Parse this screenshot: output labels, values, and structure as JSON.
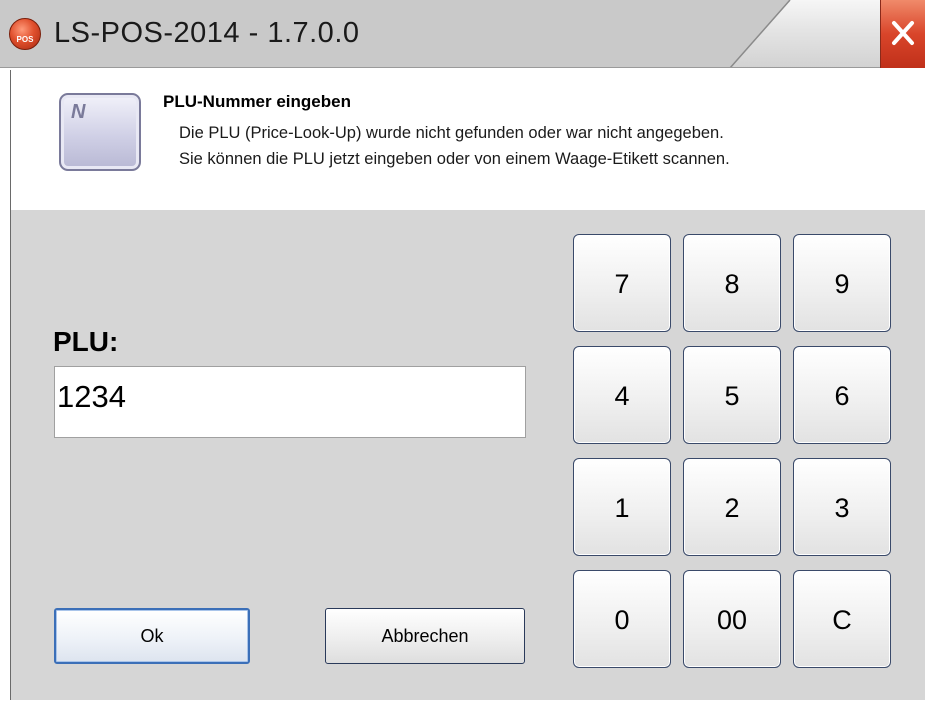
{
  "window": {
    "title": "LS-POS-2014 - 1.7.0.0",
    "app_icon_text": "POS",
    "close_icon": "close-icon"
  },
  "header": {
    "icon_letter": "N",
    "title": "PLU-Nummer eingeben",
    "line1": "Die PLU (Price-Look-Up) wurde nicht gefunden oder war nicht angegeben.",
    "line2": "Sie können die PLU jetzt eingeben oder von einem Waage-Etikett scannen."
  },
  "plu": {
    "label": "PLU:",
    "value": "1234"
  },
  "keypad": {
    "k7": "7",
    "k8": "8",
    "k9": "9",
    "k4": "4",
    "k5": "5",
    "k6": "6",
    "k1": "1",
    "k2": "2",
    "k3": "3",
    "k0": "0",
    "k00": "00",
    "kc": "C"
  },
  "buttons": {
    "ok": "Ok",
    "cancel": "Abbrechen"
  },
  "colors": {
    "close_button": "#d9452a",
    "body_background": "#d6d6d6",
    "ok_border": "#3b6fb8"
  }
}
